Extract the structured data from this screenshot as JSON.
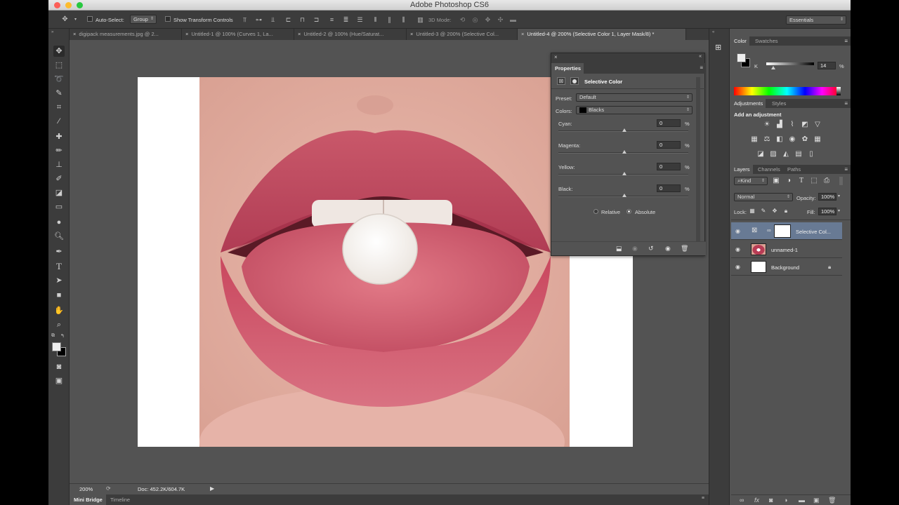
{
  "window": {
    "title": "Adobe Photoshop CS6"
  },
  "options_bar": {
    "auto_select_label": "Auto-Select:",
    "auto_select_value": "Group",
    "transform_label": "Show Transform Controls",
    "mode_3d_label": "3D Mode:",
    "workspace": "Essentials"
  },
  "tabs": [
    {
      "label": "digipack measurements.jpg @ 2...",
      "active": false
    },
    {
      "label": "Untitled-1 @ 100% (Curves 1, La...",
      "active": false
    },
    {
      "label": "Untitled-2 @ 100% (Hue/Saturat...",
      "active": false
    },
    {
      "label": "Untitled-3 @ 200% (Selective Col...",
      "active": false
    },
    {
      "label": "Untitled-4 @ 200% (Selective Color 1, Layer Mask/8) *",
      "active": true
    }
  ],
  "status": {
    "zoom": "200%",
    "doc": "Doc: 452.2K/604.7K"
  },
  "bottom_tabs": [
    "Mini Bridge",
    "Timeline"
  ],
  "properties": {
    "title": "Properties",
    "adjustment_name": "Selective Color",
    "preset_label": "Preset:",
    "preset_value": "Default",
    "colors_label": "Colors:",
    "colors_value": "Blacks",
    "sliders": [
      {
        "label": "Cyan:",
        "value": "0",
        "unit": "%"
      },
      {
        "label": "Magenta:",
        "value": "0",
        "unit": "%"
      },
      {
        "label": "Yellow:",
        "value": "0",
        "unit": "%"
      },
      {
        "label": "Black:",
        "value": "0",
        "unit": "%"
      }
    ],
    "method": {
      "relative": "Relative",
      "absolute": "Absolute",
      "selected": "Absolute"
    }
  },
  "color_panel": {
    "tabs": [
      "Color",
      "Swatches"
    ],
    "channel": "K",
    "value": "14",
    "unit": "%"
  },
  "adjustments_panel": {
    "tabs": [
      "Adjustments",
      "Styles"
    ],
    "heading": "Add an adjustment"
  },
  "layers_panel": {
    "tabs": [
      "Layers",
      "Channels",
      "Paths"
    ],
    "filter": "Kind",
    "blend_mode": "Normal",
    "opacity_label": "Opacity:",
    "opacity_value": "100%",
    "lock_label": "Lock:",
    "fill_label": "Fill:",
    "fill_value": "100%",
    "layers": [
      {
        "name": "Selective Col...",
        "selected": true
      },
      {
        "name": "unnamed-1",
        "selected": false
      },
      {
        "name": "Background",
        "selected": false
      }
    ]
  },
  "colors": {
    "panel_bg": "#535353",
    "dark_bg": "#3c3c3c",
    "selection": "#687a94"
  }
}
